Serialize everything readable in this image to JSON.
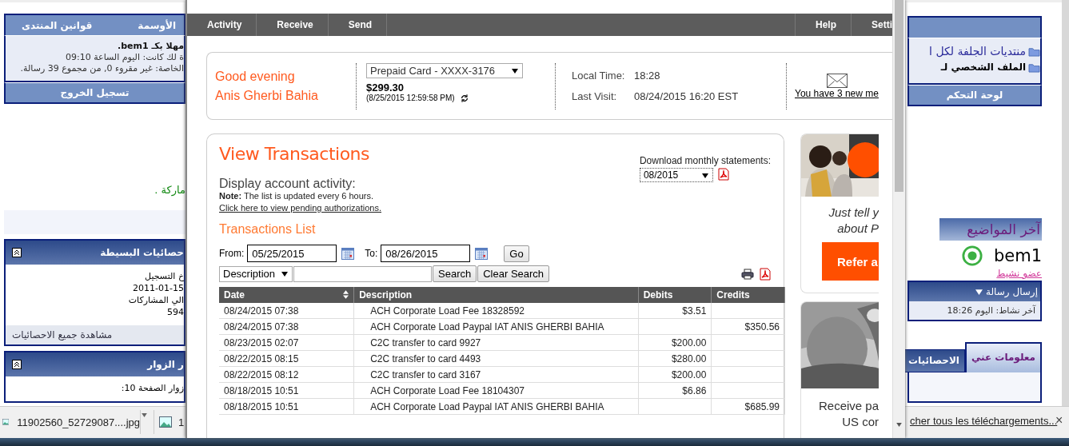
{
  "forum_left": {
    "menu": [
      "الأوسمة",
      "قوانين المنتدى"
    ],
    "welcome": [
      "مهلا بكـ bem1.",
      "ة لك كانت: اليوم الساعة 09:10",
      "الخاصة: غير مقروء 0, من مجموع 39 رسالة."
    ],
    "logout": "تسجيل الخروج",
    "notice": "ماركة .",
    "stats": {
      "title": "حصائيات البسيطة",
      "lines": [
        "خ التسجيل",
        "2011-01-15",
        "الي المشاركات",
        "594"
      ],
      "footer": "مشاهدة جميع الاحصائيات"
    },
    "visitors": {
      "title": "ر الزوار",
      "line": "زوار الصفحة 10:"
    }
  },
  "forum_right": {
    "links": [
      "منتديات الجلفة لكل ا",
      "الملف الشخصي لـ"
    ],
    "control_panel": "لوحة التحكم",
    "latest": "آخر المواضيع",
    "user": "bem1",
    "rank": "عضو نشيط",
    "send": "إرسال رسالة",
    "last_activity": "آخر نشاط: اليوم 18:26",
    "tabs": [
      {
        "label": "معلومات عني",
        "selected": true
      },
      {
        "label": "الاحصائيات",
        "selected": false
      }
    ]
  },
  "popup": {
    "nav_left": [
      "Activity",
      "Receive",
      "Send"
    ],
    "nav_right": [
      "Help",
      "Setti"
    ],
    "greeting": [
      "Good evening",
      "Anis Gherbi Bahia"
    ],
    "card": {
      "value": "Prepaid Card - XXXX-3176",
      "balance": "$299.30",
      "as_of": "(8/25/2015 12:59:58 PM)"
    },
    "local_time_label": "Local Time:",
    "local_time": "18:28",
    "last_visit_label": "Last Visit:",
    "last_visit": "08/24/2015 16:20 EST",
    "messages": "You have 3 new me",
    "title": "View Transactions",
    "statements_label": "Download monthly statements:",
    "statement_month": "08/2015",
    "activity_label": "Display account activity:",
    "note_bold": "Note:",
    "note": "The list is updated every 6 hours.",
    "pending_link": "Click here to view pending authorizations.",
    "list_title": "Transactions List",
    "from_label": "From:",
    "from": "05/25/2015",
    "to_label": "To:",
    "to": "08/26/2015",
    "go": "Go",
    "filter": "Description",
    "search": "Search",
    "clear": "Clear Search",
    "columns": [
      "Date",
      "Description",
      "Debits",
      "Credits"
    ],
    "rows": [
      {
        "date": "08/24/2015 07:38",
        "description": "ACH Corporate Load Fee 18328592",
        "debit": "$3.51",
        "credit": ""
      },
      {
        "date": "08/24/2015 07:38",
        "description": "ACH Corporate Load Paypal IAT ANIS GHERBI BAHIA",
        "debit": "",
        "credit": "$350.56"
      },
      {
        "date": "08/23/2015 02:07",
        "description": "C2C transfer to card 9927",
        "debit": "$200.00",
        "credit": ""
      },
      {
        "date": "08/22/2015 08:15",
        "description": "C2C transfer to card 4493",
        "debit": "$280.00",
        "credit": ""
      },
      {
        "date": "08/22/2015 08:12",
        "description": "C2C transfer to card 3167",
        "debit": "$200.00",
        "credit": ""
      },
      {
        "date": "08/18/2015 10:51",
        "description": "ACH Corporate Load Fee 18104307",
        "debit": "$6.86",
        "credit": ""
      },
      {
        "date": "08/18/2015 10:51",
        "description": "ACH Corporate Load Paypal IAT ANIS GHERBI BAHIA",
        "debit": "",
        "credit": "$685.99"
      }
    ],
    "promo1": {
      "lines": [
        "Just tell y",
        "about P"
      ],
      "button": "Refer a"
    },
    "promo2": {
      "lines": [
        "Receive pa",
        "US cor"
      ]
    }
  },
  "downloads": {
    "file": "11902560_52729087....jpg",
    "file2": "1",
    "show_all": "cher tous les téléchargements...",
    "close": "×"
  }
}
